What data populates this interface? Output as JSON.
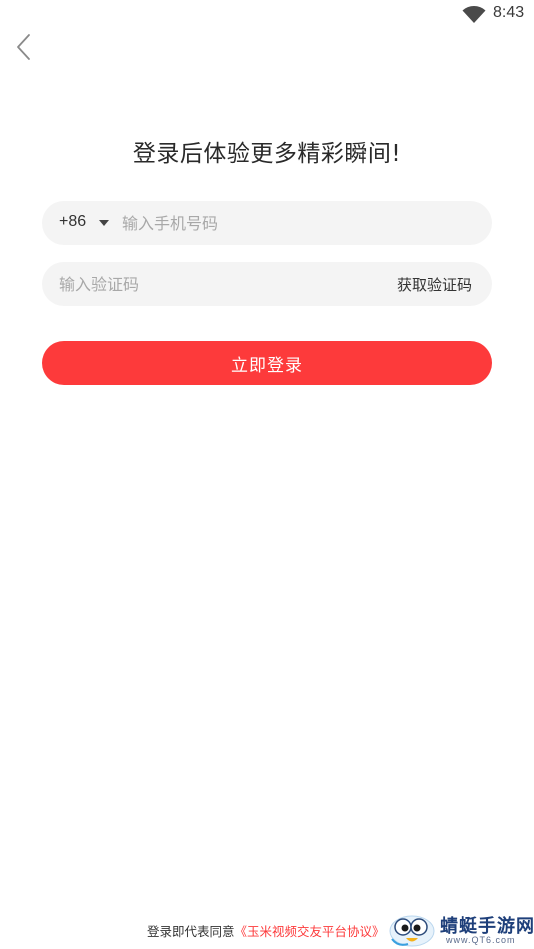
{
  "status_bar": {
    "time": "8:43",
    "wifi_icon": "wifi-icon"
  },
  "nav": {
    "back_icon": "chevron-left-icon"
  },
  "login": {
    "headline": "登录后体验更多精彩瞬间!",
    "phone": {
      "country_code": "+86",
      "dropdown_icon": "caret-down-icon",
      "placeholder": "输入手机号码",
      "value": ""
    },
    "code": {
      "placeholder": "输入验证码",
      "value": "",
      "get_code_label": "获取验证码"
    },
    "submit_label": "立即登录"
  },
  "footer": {
    "agreement_prefix": "登录即代表同意",
    "agreement_link": "《玉米视频交友平台协议》"
  },
  "watermark": {
    "name": "蜻蜓手游网",
    "url": "www.QT6.com"
  },
  "colors": {
    "accent": "#fd3a3b",
    "field_bg": "#f4f4f4",
    "watermark_text": "#1e3f7a"
  }
}
